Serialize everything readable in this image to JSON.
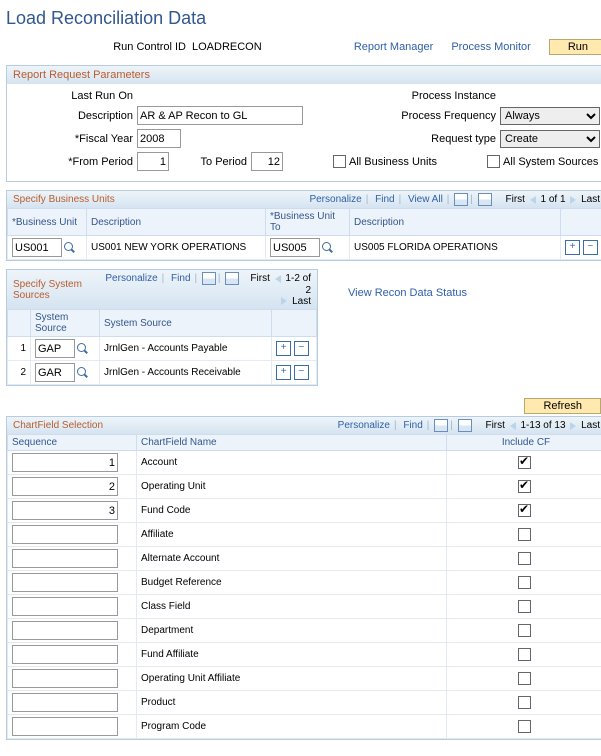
{
  "title": "Load Reconciliation Data",
  "runControl": {
    "label": "Run Control ID",
    "value": "LOADRECON"
  },
  "topLinks": {
    "reportManager": "Report Manager",
    "processMonitor": "Process Monitor",
    "run": "Run"
  },
  "params": {
    "title": "Report Request Parameters",
    "lastRunOnLabel": "Last Run On",
    "lastRunOn": "",
    "processInstanceLabel": "Process Instance",
    "processInstance": "",
    "descriptionLabel": "Description",
    "description": "AR & AP Recon to GL",
    "fiscalYearLabel": "*Fiscal Year",
    "fiscalYear": "2008",
    "fromPeriodLabel": "*From Period",
    "fromPeriod": "1",
    "toPeriodLabel": "To Period",
    "toPeriod": "12",
    "allBULabel": "All Business Units",
    "allSysLabel": "All System Sources",
    "freqLabel": "Process Frequency",
    "freq": "Always",
    "reqTypeLabel": "Request type",
    "reqType": "Create"
  },
  "bu": {
    "title": "Specify Business Units",
    "tools": {
      "personalize": "Personalize",
      "find": "Find",
      "viewAll": "View All"
    },
    "nav": {
      "first": "First",
      "pos": "1 of 1",
      "last": "Last"
    },
    "cols": {
      "bu": "*Business Unit",
      "desc": "Description",
      "buTo": "*Business Unit To",
      "descTo": "Description"
    },
    "row": {
      "bu": "US001",
      "desc": "US001 NEW YORK OPERATIONS",
      "buTo": "US005",
      "descTo": "US005 FLORIDA OPERATIONS"
    }
  },
  "sys": {
    "title": "Specify System Sources",
    "tools": {
      "personalize": "Personalize",
      "find": "Find"
    },
    "nav": {
      "first": "First",
      "pos": "1-2 of 2",
      "last": "Last"
    },
    "cols": {
      "src": "System Source",
      "desc": "System Source"
    },
    "rows": [
      {
        "n": "1",
        "src": "GAP",
        "desc": "JrnlGen - Accounts Payable"
      },
      {
        "n": "2",
        "src": "GAR",
        "desc": "JrnlGen - Accounts Receivable"
      }
    ],
    "viewStatus": "View Recon Data Status"
  },
  "refresh": "Refresh",
  "cf": {
    "title": "ChartField Selection",
    "tools": {
      "personalize": "Personalize",
      "find": "Find"
    },
    "nav": {
      "first": "First",
      "pos": "1-13 of 13",
      "last": "Last"
    },
    "cols": {
      "seq": "Sequence",
      "name": "ChartField Name",
      "inc": "Include CF"
    },
    "rows": [
      {
        "seq": "1",
        "name": "Account",
        "inc": true
      },
      {
        "seq": "2",
        "name": "Operating Unit",
        "inc": true
      },
      {
        "seq": "3",
        "name": "Fund Code",
        "inc": true
      },
      {
        "seq": "",
        "name": "Affiliate",
        "inc": false
      },
      {
        "seq": "",
        "name": "Alternate Account",
        "inc": false
      },
      {
        "seq": "",
        "name": "Budget Reference",
        "inc": false
      },
      {
        "seq": "",
        "name": "Class Field",
        "inc": false
      },
      {
        "seq": "",
        "name": "Department",
        "inc": false
      },
      {
        "seq": "",
        "name": "Fund Affiliate",
        "inc": false
      },
      {
        "seq": "",
        "name": "Operating Unit Affiliate",
        "inc": false
      },
      {
        "seq": "",
        "name": "Product",
        "inc": false
      },
      {
        "seq": "",
        "name": "Program Code",
        "inc": false
      }
    ]
  }
}
